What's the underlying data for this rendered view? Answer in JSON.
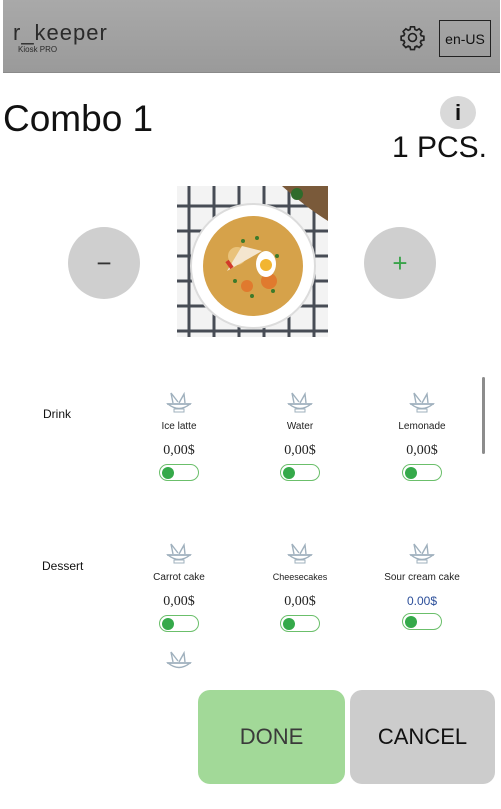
{
  "header": {
    "logo_text": "r_keeper",
    "logo_subtitle": "Kiosk PRO",
    "settings_icon": "gear-icon",
    "language": "en-US"
  },
  "product": {
    "title": "Combo 1",
    "info_label": "i",
    "quantity": "1 PCS.",
    "minus_label": "−",
    "plus_label": "+",
    "image": "soup-bowl"
  },
  "groups": [
    {
      "label": "Drink",
      "options": [
        {
          "name": "Ice latte",
          "price": "0,00$",
          "icon": "dish-icon",
          "selected": false
        },
        {
          "name": "Water",
          "price": "0,00$",
          "icon": "dish-icon",
          "selected": false
        },
        {
          "name": "Lemonade",
          "price": "0,00$",
          "icon": "dish-icon",
          "selected": false
        }
      ]
    },
    {
      "label": "Dessert",
      "options": [
        {
          "name": "Carrot cake",
          "price": "0,00$",
          "icon": "dish-icon",
          "selected": false
        },
        {
          "name": "Cheesecakes",
          "price": "0,00$",
          "icon": "dish-icon",
          "selected": false
        },
        {
          "name": "Sour cream cake",
          "price": "0.00$",
          "icon": "dish-icon",
          "selected": false
        }
      ]
    }
  ],
  "footer": {
    "done_label": "DONE",
    "cancel_label": "CANCEL"
  },
  "colors": {
    "header_bg": "#a3a3a3",
    "accent_green": "#35a94a",
    "done_bg": "#a2d998",
    "cancel_bg": "#cccccc"
  }
}
